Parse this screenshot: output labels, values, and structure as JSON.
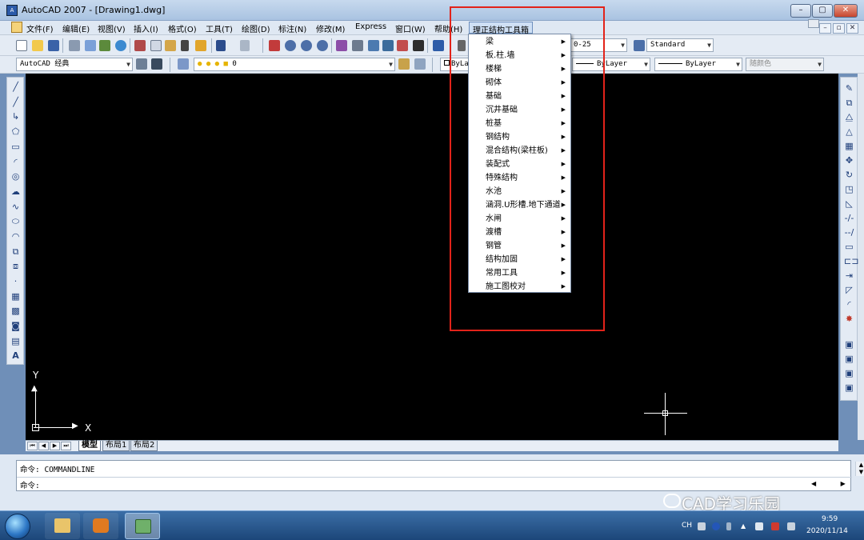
{
  "window": {
    "title": "AutoCAD 2007 - [Drawing1.dwg]",
    "app_icon": "autocad-app-icon",
    "minimize": "–",
    "maximize": "▢",
    "close": "✕"
  },
  "menubar": {
    "items": [
      "文件(F)",
      "编辑(E)",
      "视图(V)",
      "插入(I)",
      "格式(O)",
      "工具(T)",
      "绘图(D)",
      "标注(N)",
      "修改(M)",
      "Express",
      "窗口(W)",
      "帮助(H)"
    ],
    "toolbox": "理正结构工具箱",
    "mdi_minimize": "–",
    "mdi_restore": "▫",
    "mdi_close": "✕"
  },
  "toolbar1": {
    "dimstyle_partial": "0-25",
    "textstyle": "Standard"
  },
  "toolbar2": {
    "workspace": "AutoCAD 经典",
    "layer": "0",
    "color_partial": "ByLa",
    "linetype": "ByLayer",
    "lineweight": "ByLayer",
    "plotstyle": "随颜色"
  },
  "toolbox_menu": {
    "items": [
      "梁",
      "板.柱.墙",
      "楼梯",
      "砌体",
      "基础",
      "沉井基础",
      "桩基",
      "钢结构",
      "混合结构(梁柱板)",
      "装配式",
      "特殊结构",
      "水池",
      "涵洞.U形槽.地下通道",
      "水闸",
      "渡槽",
      "钢管",
      "结构加固",
      "常用工具",
      "施工图校对"
    ],
    "submenu_arrow": "▶"
  },
  "ucs": {
    "x": "X",
    "y": "Y"
  },
  "layout_tabs": {
    "model": "模型",
    "layout1": "布局1",
    "layout2": "布局2"
  },
  "nav": {
    "first": "⏮",
    "prev": "◀",
    "next": "▶",
    "last": "⏭"
  },
  "command": {
    "history": "命令: COMMANDLINE",
    "prompt": "命令:"
  },
  "watermark": "CAD学习乐园",
  "tray": {
    "lang": "CH",
    "time": "9:59",
    "date": "2020/11/14"
  },
  "colors": {
    "canvas": "#000000",
    "highlight": "#e2231a",
    "taskbar": "#1c4679"
  }
}
